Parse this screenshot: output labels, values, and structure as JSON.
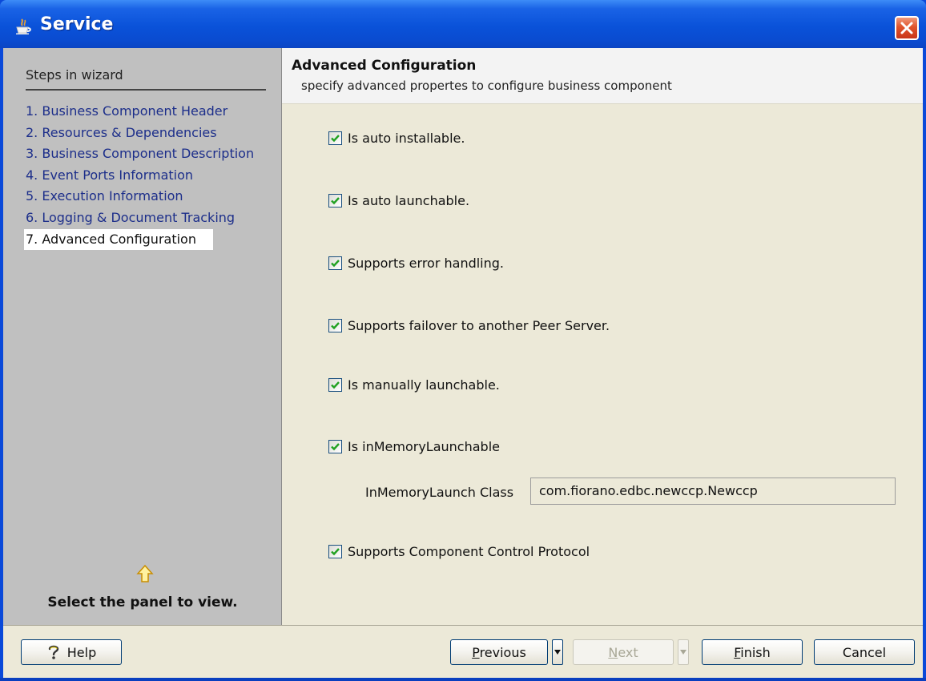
{
  "window": {
    "title": "Service"
  },
  "sidebar": {
    "title": "Steps in wizard",
    "steps": [
      "1. Business Component Header",
      "2. Resources & Dependencies",
      "3. Business Component Description",
      "4. Event Ports Information",
      "5. Execution Information",
      "6. Logging & Document Tracking",
      "7. Advanced Configuration"
    ],
    "active_step": 7,
    "hint": "Select the panel to view."
  },
  "main": {
    "title": "Advanced Configuration",
    "subtitle": "specify advanced propertes to configure business component",
    "options": [
      {
        "label": "Is auto installable.",
        "checked": true
      },
      {
        "label": "Is auto launchable.",
        "checked": true
      },
      {
        "label": "Supports error handling.",
        "checked": true
      },
      {
        "label": "Supports failover to another Peer Server.",
        "checked": true
      },
      {
        "label": "Is manually launchable.",
        "checked": true
      },
      {
        "label": "Is inMemoryLaunchable",
        "checked": true
      },
      {
        "label": "Supports Component Control Protocol",
        "checked": true
      }
    ],
    "launch_class": {
      "label": "InMemoryLaunch Class",
      "value": "com.fiorano.edbc.newccp.Newccp"
    }
  },
  "footer": {
    "help": "Help",
    "previous": {
      "pre": "",
      "mnemonic": "P",
      "post": "revious"
    },
    "next": {
      "pre": "",
      "mnemonic": "N",
      "post": "ext"
    },
    "finish": {
      "pre": "",
      "mnemonic": "F",
      "post": "inish"
    },
    "cancel": "Cancel"
  },
  "colors": {
    "titlebar": "#0a52d9",
    "sidebar_bg": "#c0c0c0",
    "panel_bg": "#ece9d8",
    "checkmark": "#21a121",
    "step_link": "#1c2e8a"
  },
  "icons": {
    "title": "java-cup-icon",
    "close": "close-icon",
    "hint": "up-arrow-icon",
    "help": "question-mark-icon",
    "dropdown": "triangle-down-icon"
  }
}
